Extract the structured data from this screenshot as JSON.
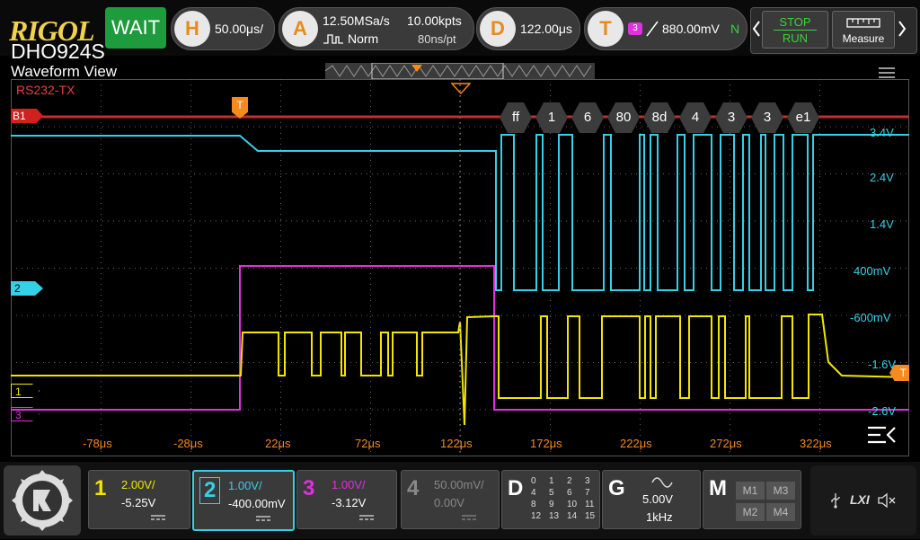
{
  "brand": "RIGOL",
  "model": "DHO924S",
  "status": "WAIT",
  "horizontal": {
    "key": "H",
    "value": "50.00μs/"
  },
  "acquire": {
    "key": "A",
    "rate": "12.50MSa/s",
    "points": "10.00kpts",
    "mode": "Norm",
    "resolution": "80ns/pt"
  },
  "delay": {
    "key": "D",
    "value": "122.00μs"
  },
  "trigger": {
    "key": "T",
    "channel": "3",
    "level": "880.00mV",
    "coupling": "N"
  },
  "run_control": {
    "stop": "STOP",
    "run": "RUN"
  },
  "measure_label": "Measure",
  "view_title": "Waveform View",
  "bus_label": "RS232-TX",
  "bus_marker": "B1",
  "decode_bytes": [
    "ff",
    "1",
    "6",
    "80",
    "8d",
    "4",
    "3",
    "3",
    "e1"
  ],
  "ch2_marker": "2",
  "ch1_marker": "1",
  "ch3_marker": "3",
  "trig_marker": "T",
  "right_scale": [
    "3.4V",
    "2.4V",
    "1.4V",
    "400mV",
    "-600mV",
    "-1.6V",
    "-2.6V"
  ],
  "time_axis": [
    "-78μs",
    "-28μs",
    "22μs",
    "72μs",
    "122μs",
    "172μs",
    "222μs",
    "272μs",
    "322μs"
  ],
  "channels": [
    {
      "num": "1",
      "scale": "2.00V/",
      "offset": "-5.25V",
      "color": "#f2e600"
    },
    {
      "num": "2",
      "scale": "1.00V/",
      "offset": "-400.00mV",
      "color": "#36d0e6"
    },
    {
      "num": "3",
      "scale": "1.00V/",
      "offset": "-3.12V",
      "color": "#e030e0"
    },
    {
      "num": "4",
      "scale": "50.00mV/",
      "offset": "0.00V",
      "color": "#888888"
    }
  ],
  "digital": {
    "key": "D",
    "numbers": [
      "0",
      "1",
      "2",
      "3",
      "4",
      "5",
      "6",
      "7",
      "8",
      "9",
      "10",
      "11",
      "12",
      "13",
      "14",
      "15"
    ]
  },
  "generator": {
    "key": "G",
    "amplitude": "5.00V",
    "frequency": "1kHz"
  },
  "math": {
    "key": "M",
    "items": [
      "M1",
      "M3",
      "M2",
      "M4"
    ]
  },
  "lxi": "LXI"
}
